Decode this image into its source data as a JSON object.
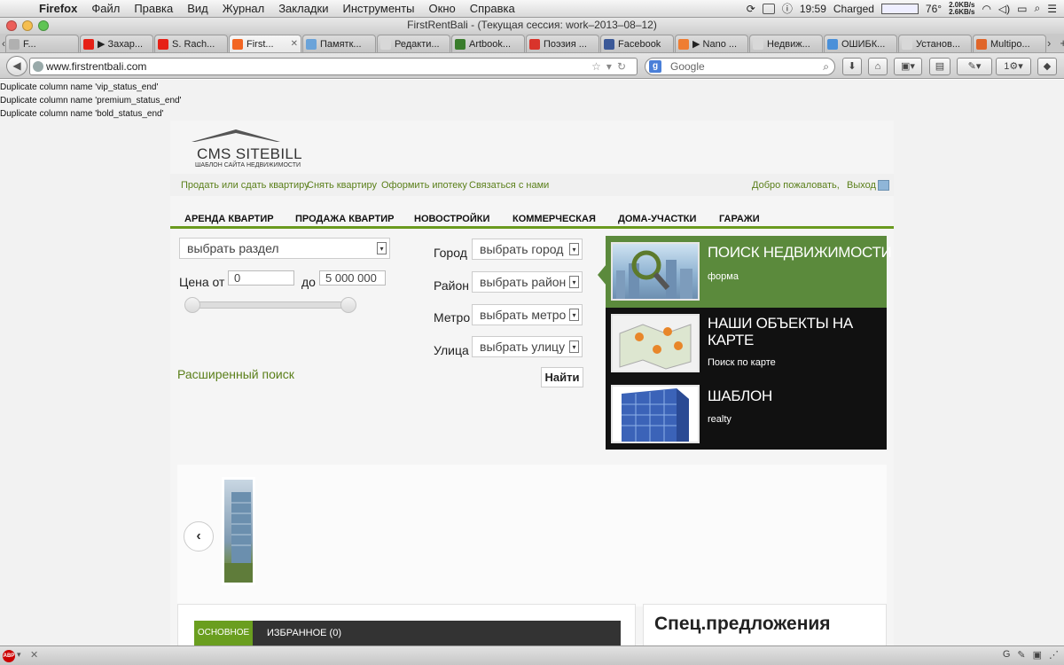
{
  "menubar": {
    "app": "Firefox",
    "items": [
      "Файл",
      "Правка",
      "Вид",
      "Журнал",
      "Закладки",
      "Инструменты",
      "Окно",
      "Справка"
    ],
    "clock": "19:59",
    "battery_status": "Charged",
    "temperature": "76°",
    "net_up": "2.0KB/s",
    "net_down": "2.6KB/s"
  },
  "window": {
    "title": "FirstRentBali - (Текущая сессия: work–2013–08–12)"
  },
  "tabs": [
    {
      "label": "F...",
      "favicon_color": "#b0b0b0"
    },
    {
      "label": "▶ Захар...",
      "favicon_color": "#e62117"
    },
    {
      "label": "S. Rach...",
      "favicon_color": "#e62117"
    },
    {
      "label": "First...",
      "favicon_color": "#f26522",
      "active": true
    },
    {
      "label": "Памятк...",
      "favicon_color": "#6aa3d9"
    },
    {
      "label": "Редакти...",
      "favicon_color": "#d8d8d8"
    },
    {
      "label": "Artbook...",
      "favicon_color": "#3a7d2c"
    },
    {
      "label": "Поэзия ...",
      "favicon_color": "#d9342b"
    },
    {
      "label": "Facebook",
      "favicon_color": "#3b5998"
    },
    {
      "label": "▶ Nano ...",
      "favicon_color": "#ef7d32"
    },
    {
      "label": "Недвиж...",
      "favicon_color": "#d8d8d8"
    },
    {
      "label": "ОШИБК...",
      "favicon_color": "#4a90d9"
    },
    {
      "label": "Установ...",
      "favicon_color": "#d8d8d8"
    },
    {
      "label": "Multipo...",
      "favicon_color": "#e0662a"
    }
  ],
  "navbar": {
    "url": "www.firstrentbali.com",
    "search_placeholder": "Google"
  },
  "errors": [
    "Duplicate column name 'vip_status_end'",
    "Duplicate column name 'premium_status_end'",
    "Duplicate column name 'bold_status_end'"
  ],
  "site": {
    "logo": {
      "name": "CMS SITEBILL",
      "tagline": "ШАБЛОН САЙТА НЕДВИЖИМОСТИ"
    },
    "toplinks": [
      "Продать или сдать квартиру",
      "Снять квартиру",
      "Оформить ипотеку",
      "Связаться с нами"
    ],
    "welcome": "Добро пожаловать,",
    "logout": "Выход",
    "mainnav": [
      "АРЕНДА КВАРТИР",
      "ПРОДАЖА КВАРТИР",
      "НОВОСТРОЙКИ",
      "КОММЕРЧЕСКАЯ",
      "ДОМА-УЧАСТКИ",
      "ГАРАЖИ"
    ],
    "search": {
      "section_select": "выбрать раздел",
      "price_from_label": "Цена от",
      "price_from": "0",
      "price_to_label": "до",
      "price_to": "5 000 000",
      "city_label": "Город",
      "city_select": "выбрать город",
      "district_label": "Район",
      "district_select": "выбрать район",
      "metro_label": "Метро",
      "metro_select": "выбрать метро",
      "street_label": "Улица",
      "street_select": "выбрать улицу",
      "advanced_link": "Расширенный поиск",
      "find_button": "Найти"
    },
    "promo": [
      {
        "title": "ПОИСК НЕДВИЖИМОСТИ",
        "subtitle": "форма"
      },
      {
        "title": "НАШИ ОБЪЕКТЫ НА КАРТЕ",
        "subtitle": "Поиск по карте"
      },
      {
        "title": "ШАБЛОН",
        "subtitle": "realty"
      }
    ],
    "bottom_tabs": {
      "active": "ОСНОВНОЕ",
      "inactive": "ИЗБРАННОЕ (0)"
    },
    "special_offers_title": "Спец.предложения"
  },
  "colors": {
    "accent_green": "#6a9a1f",
    "link_green": "#5a7f19",
    "promo_active": "#5b8a3c",
    "promo_bg": "#111111"
  }
}
